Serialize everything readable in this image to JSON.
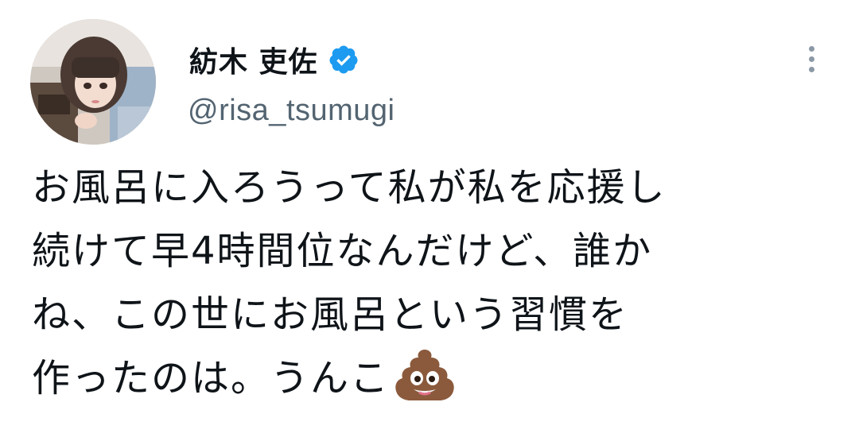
{
  "user": {
    "display_name": "紡木 吏佐",
    "handle": "@risa_tsumugi",
    "verified": true,
    "avatar_icon": "profile-photo",
    "verified_icon": "verified-badge-icon"
  },
  "tweet": {
    "lines": [
      "お風呂に入ろうって私が私を応援し",
      "続けて早4時間位なんだけど、誰か",
      "ね、この世にお風呂という習慣を",
      "作ったのは。うんこ"
    ],
    "emoji": "pile-of-poo-icon"
  },
  "menu": {
    "icon": "more-vertical-icon"
  },
  "colors": {
    "verified_blue": "#1d9bf0",
    "handle_gray": "#536471",
    "text": "#0f1419"
  }
}
